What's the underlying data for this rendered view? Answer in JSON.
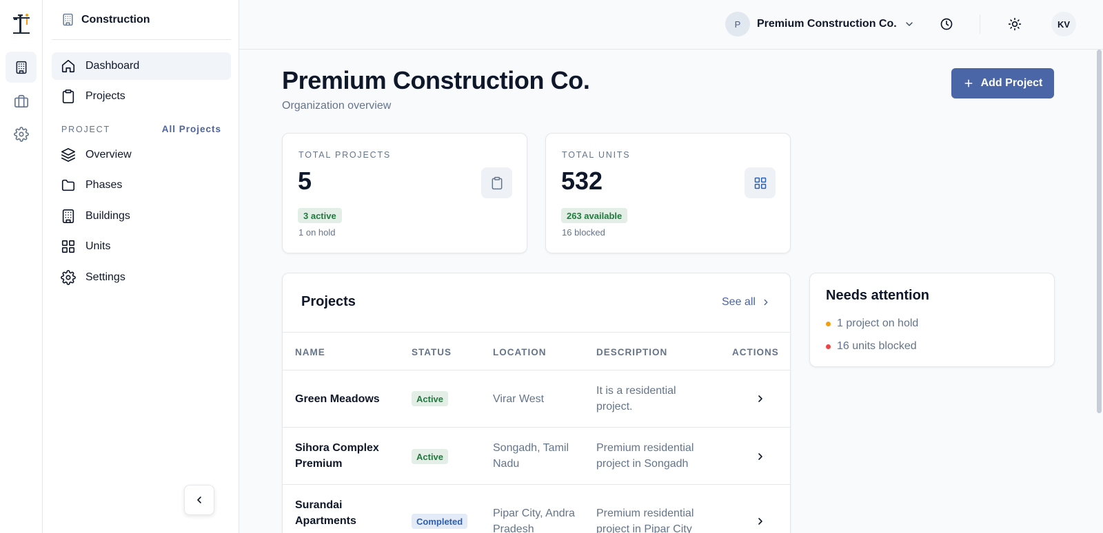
{
  "sidebar": {
    "header_title": "Construction",
    "nav": [
      {
        "label": "Dashboard",
        "icon": "home-icon"
      },
      {
        "label": "Projects",
        "icon": "clipboard-icon"
      }
    ],
    "section_label": "PROJECT",
    "section_link": "All Projects",
    "project_nav": [
      {
        "label": "Overview",
        "icon": "layers-icon"
      },
      {
        "label": "Phases",
        "icon": "folder-icon"
      },
      {
        "label": "Buildings",
        "icon": "building-icon"
      },
      {
        "label": "Units",
        "icon": "grid-icon"
      },
      {
        "label": "Settings",
        "icon": "gear-icon"
      }
    ]
  },
  "topbar": {
    "org_initial": "P",
    "org_name": "Premium Construction Co.",
    "user_initials": "KV"
  },
  "main": {
    "title": "Premium Construction Co.",
    "subtitle": "Organization overview",
    "add_button": "Add Project"
  },
  "stats": [
    {
      "label": "TOTAL PROJECTS",
      "value": "5",
      "pill": "3 active",
      "note": "1 on hold",
      "icon": "clipboard-icon"
    },
    {
      "label": "TOTAL UNITS",
      "value": "532",
      "pill": "263 available",
      "note": "16 blocked",
      "icon": "grid-icon"
    }
  ],
  "projects": {
    "title": "Projects",
    "see_all": "See all",
    "columns": [
      "NAME",
      "STATUS",
      "LOCATION",
      "DESCRIPTION",
      "ACTIONS"
    ],
    "rows": [
      {
        "name": "Green Meadows",
        "status": "Active",
        "location": "Virar West",
        "description": "It is a residential project."
      },
      {
        "name": "Sihora Complex Premium",
        "status": "Active",
        "location": "Songadh, Tamil Nadu",
        "description": "Premium residential project in Songadh"
      },
      {
        "name": "Surandai Apartments",
        "status": "Completed",
        "location": "Pipar City, Andra Pradesh",
        "description": "Premium residential project in Pipar City"
      }
    ]
  },
  "attention": {
    "title": "Needs attention",
    "items": [
      {
        "text": "1 project on hold",
        "color": "#f59e0b"
      },
      {
        "text": "16 units blocked",
        "color": "#ef4444"
      }
    ]
  },
  "colors": {
    "accent": "#4a66a6",
    "active_badge": "#1f7a3d",
    "completed_badge": "#2d5fb2"
  }
}
